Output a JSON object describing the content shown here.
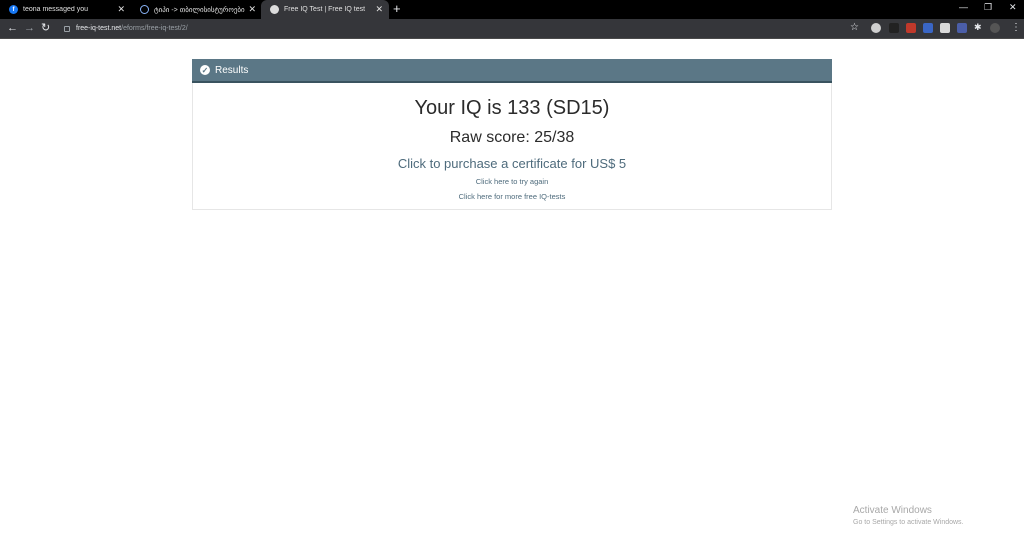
{
  "browser": {
    "tabs": [
      {
        "title": "teona messaged you",
        "favicon": "facebook-icon"
      },
      {
        "title": "ტიპი -> თბილისისტუროები",
        "favicon": "shield-icon"
      },
      {
        "title": "Free IQ Test | Free IQ test",
        "favicon": "globe-icon",
        "active": true
      }
    ],
    "new_tab": "+",
    "url_domain": "free-iq-test.net",
    "url_path": "/eforms/free-iq-test/2/"
  },
  "card": {
    "header": "Results",
    "iq_line": "Your IQ is 133 (SD15)",
    "raw_score": "Raw score: 25/38",
    "purchase_link": "Click to purchase a certificate for US$ 5",
    "try_again_link": "Click here to try again",
    "more_tests_link": "Click here for more free IQ-tests"
  },
  "watermark": {
    "title": "Activate Windows",
    "subtitle": "Go to Settings to activate Windows."
  },
  "colors": {
    "header_bg": "#5b7786",
    "link": "#4e6b7c",
    "text": "#2b2b2b"
  }
}
